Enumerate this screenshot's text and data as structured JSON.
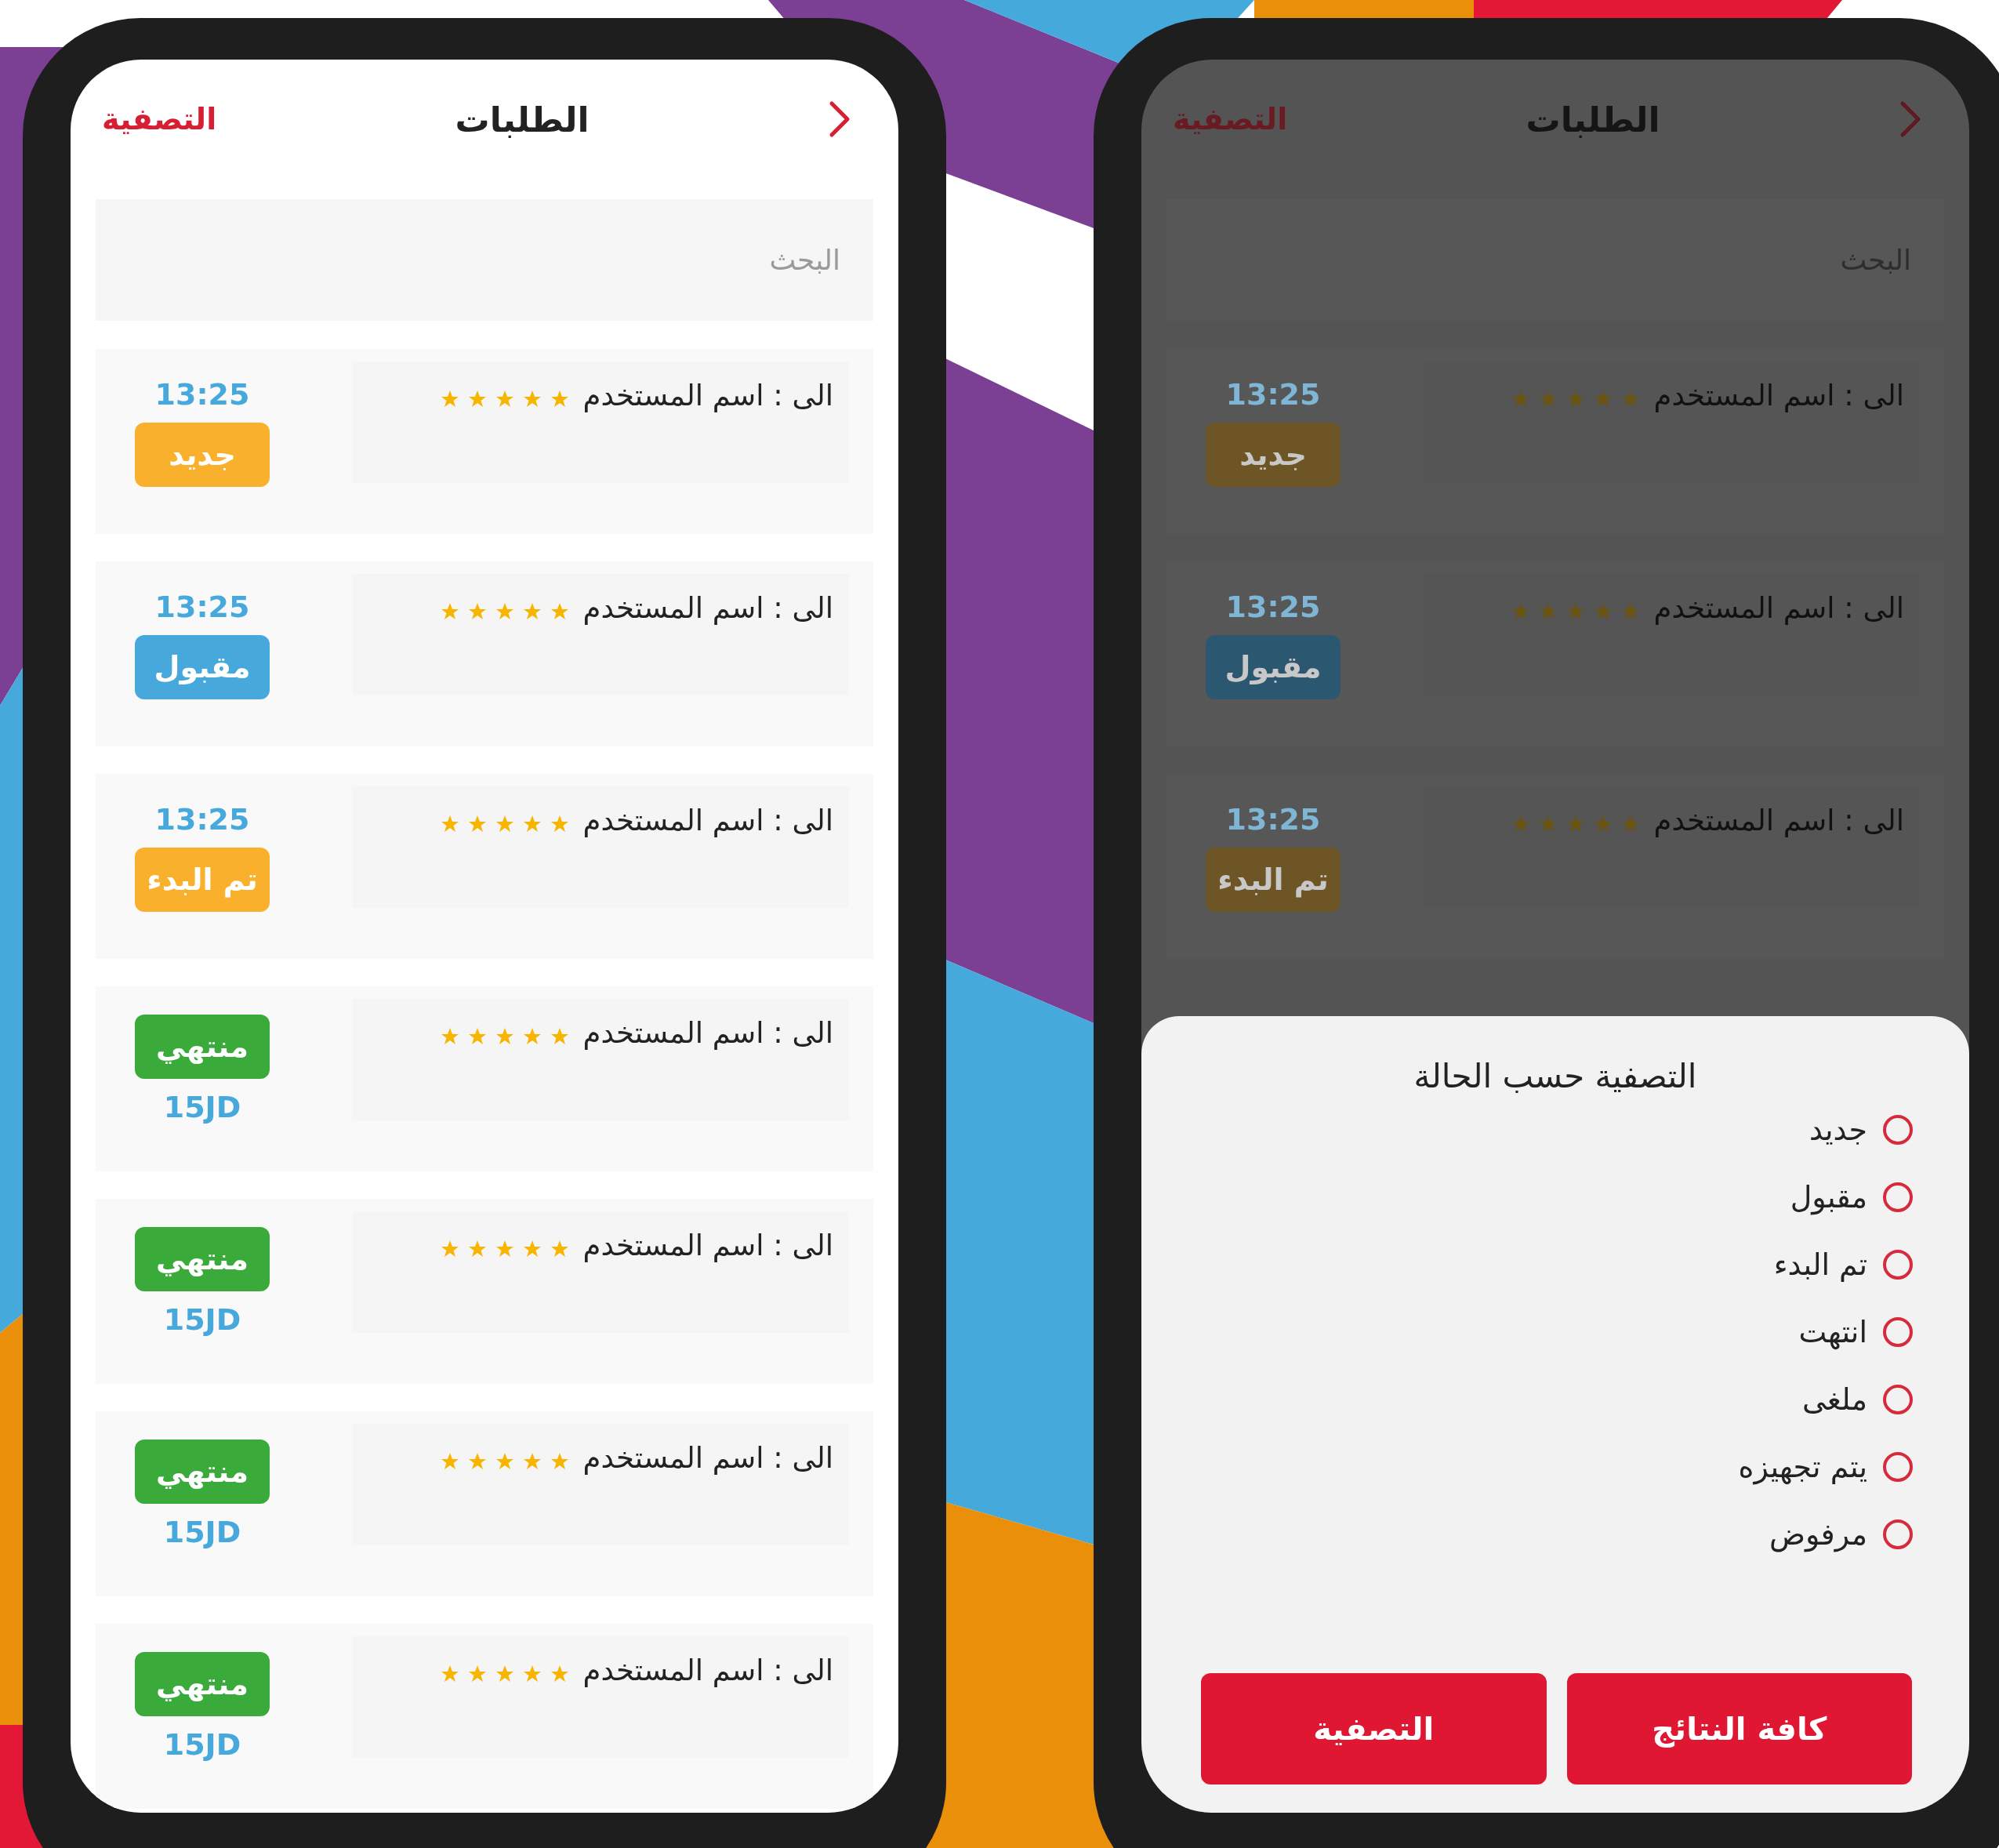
{
  "phones": [
    {
      "header": {
        "filter_link": "التصفية",
        "title": "الطلبات"
      },
      "search": {
        "placeholder": "البحث"
      },
      "dimmed": true,
      "orders": [
        {
          "recipient": "الى : اسم المستخدم",
          "stars": 5,
          "time": "13:25",
          "status": {
            "label": "جديد",
            "color": "#6e5526"
          }
        },
        {
          "recipient": "الى : اسم المستخدم",
          "stars": 5,
          "time": "13:25",
          "status": {
            "label": "مقبول",
            "color": "#2b5870"
          }
        },
        {
          "recipient": "الى : اسم المستخدم",
          "stars": 5,
          "time": "13:25",
          "status": {
            "label": "تم البدء",
            "color": "#6e5526"
          }
        }
      ],
      "filter_sheet": {
        "title": "التصفية حسب الحالة",
        "options": [
          {
            "label": "جديد",
            "selected": false
          },
          {
            "label": "مقبول",
            "selected": false
          },
          {
            "label": "تم البدء",
            "selected": false
          },
          {
            "label": "انتهت",
            "selected": false
          },
          {
            "label": "ملغى",
            "selected": false
          },
          {
            "label": "يتم تجهيزه",
            "selected": false
          },
          {
            "label": "مرفوض",
            "selected": false
          }
        ],
        "buttons": [
          "كافة النتائج",
          "التصفية"
        ]
      }
    },
    {
      "header": {
        "filter_link": "التصفية",
        "title": "الطلبات"
      },
      "search": {
        "placeholder": "البحث"
      },
      "dimmed": false,
      "orders": [
        {
          "recipient": "الى : اسم المستخدم",
          "stars": 5,
          "time": "13:25",
          "status": {
            "label": "جديد",
            "color": "#f9b12d"
          }
        },
        {
          "recipient": "الى : اسم المستخدم",
          "stars": 5,
          "time": "13:25",
          "status": {
            "label": "مقبول",
            "color": "#47a8dc"
          }
        },
        {
          "recipient": "الى : اسم المستخدم",
          "stars": 5,
          "time": "13:25",
          "status": {
            "label": "تم البدء",
            "color": "#f9b12d"
          }
        },
        {
          "recipient": "الى : اسم المستخدم",
          "stars": 5,
          "price": "15JD",
          "status": {
            "label": "منتهي",
            "color": "#3aaa3a"
          }
        },
        {
          "recipient": "الى : اسم المستخدم",
          "stars": 5,
          "price": "15JD",
          "status": {
            "label": "منتهي",
            "color": "#3aaa3a"
          }
        },
        {
          "recipient": "الى : اسم المستخدم",
          "stars": 5,
          "price": "15JD",
          "status": {
            "label": "منتهي",
            "color": "#3aaa3a"
          }
        },
        {
          "recipient": "الى : اسم المستخدم",
          "stars": 5,
          "price": "15JD",
          "status": {
            "label": "منتهي",
            "color": "#3aaa3a"
          }
        }
      ]
    }
  ]
}
